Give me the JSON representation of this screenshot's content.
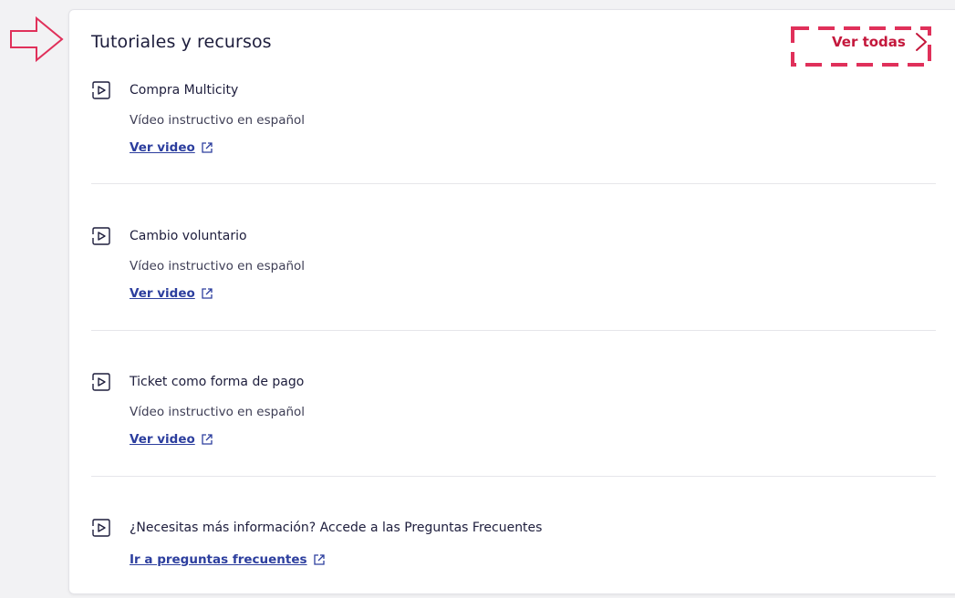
{
  "section": {
    "title": "Tutoriales y recursos",
    "see_all_label": "Ver todas"
  },
  "items": [
    {
      "title": "Compra Multicity",
      "description": "Vídeo instructivo en español",
      "link_label": "Ver video"
    },
    {
      "title": "Cambio voluntario",
      "description": "Vídeo instructivo en español",
      "link_label": "Ver video"
    },
    {
      "title": "Ticket como forma de pago",
      "description": "Vídeo instructivo en español",
      "link_label": "Ver video"
    },
    {
      "title": "¿Necesitas más información? Accede a las Preguntas Frecuentes",
      "link_label": "Ir a preguntas frecuentes"
    }
  ],
  "colors": {
    "accent_red": "#c4183c",
    "link_blue": "#2c3e9e",
    "text_dark": "#1d1d3c",
    "pointer_arrow": "#e0305a"
  },
  "icons": {
    "item": "play-video-icon",
    "link": "external-link-icon",
    "see_all": "chevron-right-icon",
    "annotation": "pointer-arrow-icon"
  }
}
